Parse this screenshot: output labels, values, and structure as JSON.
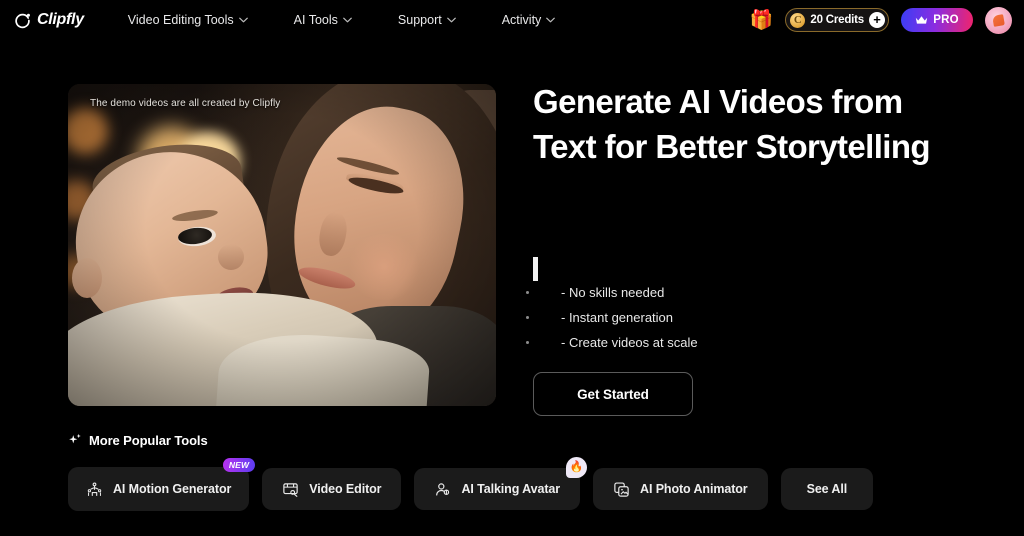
{
  "navbar": {
    "brand": "Clipfly",
    "links": [
      {
        "label": "Video Editing Tools",
        "has_dropdown": true
      },
      {
        "label": "AI Tools",
        "has_dropdown": true
      },
      {
        "label": "Support",
        "has_dropdown": true
      },
      {
        "label": "Activity",
        "has_dropdown": true
      }
    ],
    "gift_icon": "gift-icon",
    "credits": {
      "coin_letter": "C",
      "label": "20 Credits",
      "plus": "+"
    },
    "pro_label": "PRO",
    "avatar": "user-avatar"
  },
  "hero": {
    "video": {
      "caption": "The demo videos are all created by Clipfly"
    },
    "headline": "Generate AI Videos from Text for Better Storytelling",
    "bullets": [
      "- No skills needed",
      "- Instant generation",
      "- Create videos at scale"
    ],
    "cta_label": "Get Started"
  },
  "tools": {
    "title": "More Popular Tools",
    "spark_icon": "sparkle-icon",
    "items": [
      {
        "label": "AI Motion Generator",
        "icon": "motion-people-icon",
        "badge": "NEW",
        "badge_type": "new"
      },
      {
        "label": "Video Editor",
        "icon": "video-editor-icon",
        "badge": null,
        "badge_type": null
      },
      {
        "label": "AI Talking Avatar",
        "icon": "talking-avatar-icon",
        "badge": "🔥",
        "badge_type": "fire"
      },
      {
        "label": "AI Photo Animator",
        "icon": "photo-animator-icon",
        "badge": null,
        "badge_type": null
      },
      {
        "label": "See All",
        "icon": null,
        "badge": null,
        "badge_type": null
      }
    ]
  },
  "colors": {
    "background": "#000000",
    "chip_bg": "#1b1b1b",
    "pro_gradient_start": "#3b3ef5",
    "pro_gradient_end": "#f0246c",
    "credits_border": "#8a6a2a",
    "new_badge": "#b832f0"
  }
}
